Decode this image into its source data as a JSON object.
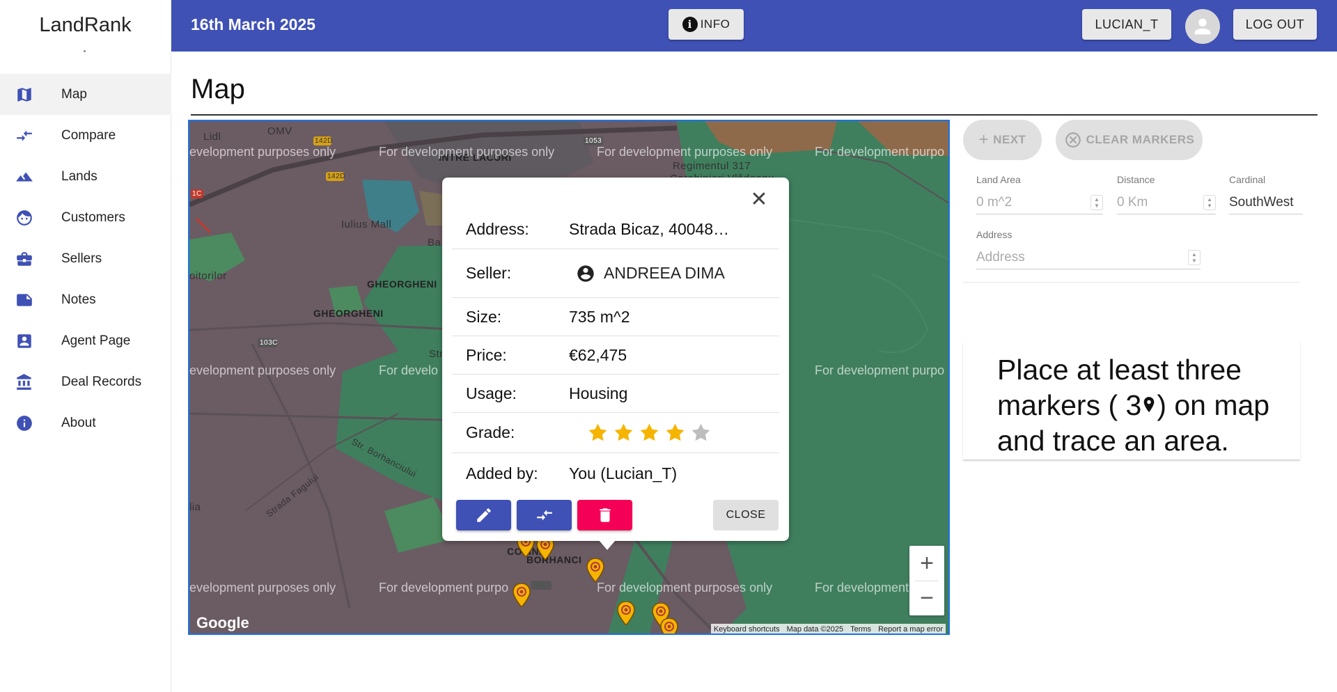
{
  "app": {
    "title": "LandRank"
  },
  "sidebar": {
    "items": [
      {
        "label": "Map",
        "icon": "map-icon",
        "active": true
      },
      {
        "label": "Compare",
        "icon": "compare-arrows-icon"
      },
      {
        "label": "Lands",
        "icon": "terrain-icon"
      },
      {
        "label": "Customers",
        "icon": "face-icon"
      },
      {
        "label": "Sellers",
        "icon": "briefcase-icon"
      },
      {
        "label": "Notes",
        "icon": "note-icon"
      },
      {
        "label": "Agent Page",
        "icon": "contact-card-icon"
      },
      {
        "label": "Deal Records",
        "icon": "bank-icon"
      },
      {
        "label": "About",
        "icon": "info-icon"
      }
    ]
  },
  "header": {
    "date": "16th March 2025",
    "info_label": "INFO",
    "user_label": "LUCIAN_T",
    "logout_label": "LOG OUT",
    "accent_color": "#3f51b5"
  },
  "page": {
    "title": "Map"
  },
  "map": {
    "watermark": "For development purposes only",
    "watermark_fragment_left": "evelopment purposes only",
    "watermark_fragment_right": "For development purpo",
    "watermark_fragment_mid": "For develo",
    "watermark_bottom_mid": "For development purpo",
    "labels": {
      "intre_lacuri": "INTRE LACURI",
      "iulius_mall": "Iulius Mall",
      "gheorgheni_1": "GHEORGHENI",
      "gheorgheni_2": "GHEORGHENI",
      "regiment": "Regimentul 317",
      "carabinieri": "Carabinieri Vlădeanu",
      "lidl": "Lidl",
      "omv": "OMV",
      "road_142d_a": "142D",
      "road_142d_b": "142D",
      "road_1c": "1C",
      "road_103c": "103C",
      "road_1053": "1053",
      "oitorilor": "oitorilor",
      "str_borhanciului": "Str. Borhanciului",
      "strada_fagului": "Strada Fagului",
      "colina": "COLINA",
      "borhanci": "BORHANCI",
      "ba": "Ba",
      "str": "Str",
      "lia": "lia",
      "a_left": "A"
    },
    "google_logo": "Google",
    "attribution": [
      "Keyboard shortcuts",
      "Map data ©2025",
      "Terms",
      "Report a map error"
    ],
    "zoom_in": "+",
    "zoom_out": "−"
  },
  "popup": {
    "rows": [
      {
        "key": "Address:",
        "value": "Strada Bicaz, 40048…"
      },
      {
        "key": "Seller:",
        "value": "ANDREEA DIMA"
      },
      {
        "key": "Size:",
        "value": "735 m^2"
      },
      {
        "key": "Price:",
        "value": "€62,475"
      },
      {
        "key": "Usage:",
        "value": "Housing"
      },
      {
        "key": "Grade:",
        "value": ""
      },
      {
        "key": "Added by:",
        "value": "You (Lucian_T)"
      }
    ],
    "grade": {
      "rating": 4,
      "max": 5,
      "filled_color": "#f5b400",
      "empty_color": "#bdbdbd"
    },
    "close_label": "CLOSE",
    "close_icon": "close-icon"
  },
  "panel": {
    "next_label": "NEXT",
    "clear_markers_label": "CLEAR MARKERS",
    "fields": {
      "land_area": {
        "label": "Land Area",
        "placeholder": "0 m^2"
      },
      "distance": {
        "label": "Distance",
        "placeholder": "0 Km"
      },
      "cardinal": {
        "label": "Cardinal",
        "value": "SouthWest"
      },
      "address": {
        "label": "Address",
        "placeholder": "Address"
      }
    },
    "hint_before": "Place at least three markers ( 3",
    "hint_after": ") on map and trace an area."
  }
}
